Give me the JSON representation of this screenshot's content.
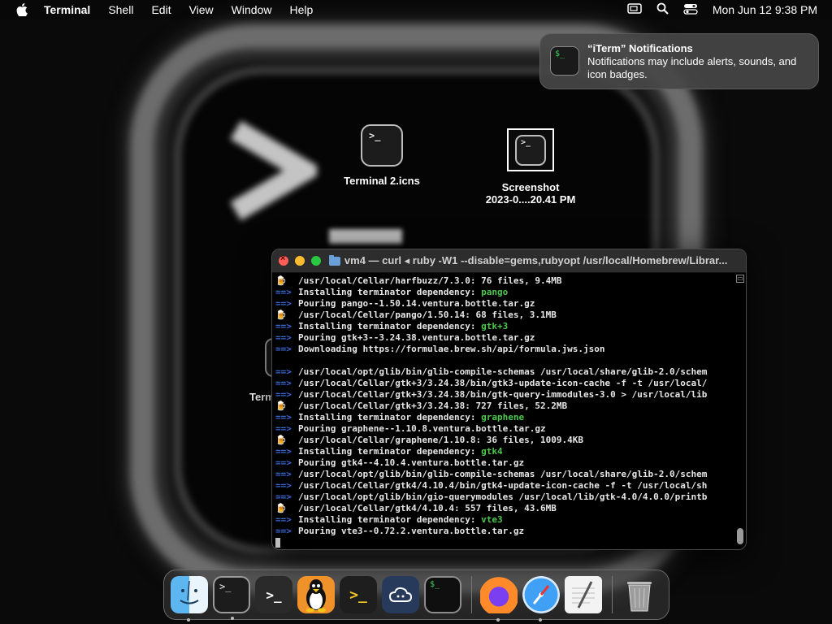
{
  "menubar": {
    "app_name": "Terminal",
    "items": [
      "Shell",
      "Edit",
      "View",
      "Window",
      "Help"
    ],
    "clock": "Mon Jun 12  9:38 PM"
  },
  "notification": {
    "title": "“iTerm” Notifications",
    "body": "Notifications may include alerts, sounds, and icon badges."
  },
  "desktop": {
    "icons": [
      {
        "label": "Terminal 2.icns"
      },
      {
        "label_line1": "Screenshot",
        "label_line2": "2023-0....20.41 PM"
      },
      {
        "label": "Term"
      }
    ]
  },
  "terminal": {
    "title": "vm4 — curl ◂ ruby -W1 --disable=gems,rubyopt /usr/local/Homebrew/Librar...",
    "lines": [
      {
        "kind": "beer",
        "text": "/usr/local/Cellar/harfbuzz/7.3.0: 76 files, 9.4MB"
      },
      {
        "kind": "arrow",
        "text": "Installing terminator dependency: ",
        "extra": "pango"
      },
      {
        "kind": "arrow",
        "text": "Pouring pango--1.50.14.ventura.bottle.tar.gz"
      },
      {
        "kind": "beer",
        "text": "/usr/local/Cellar/pango/1.50.14: 68 files, 3.1MB"
      },
      {
        "kind": "arrow",
        "text": "Installing terminator dependency: ",
        "extra": "gtk+3"
      },
      {
        "kind": "arrow",
        "text": "Pouring gtk+3--3.24.38.ventura.bottle.tar.gz"
      },
      {
        "kind": "arrow",
        "text": "Downloading https://formulae.brew.sh/api/formula.jws.json"
      },
      {
        "kind": "blank",
        "text": ""
      },
      {
        "kind": "arrow",
        "text": "/usr/local/opt/glib/bin/glib-compile-schemas /usr/local/share/glib-2.0/schem"
      },
      {
        "kind": "arrow",
        "text": "/usr/local/Cellar/gtk+3/3.24.38/bin/gtk3-update-icon-cache -f -t /usr/local/"
      },
      {
        "kind": "arrow",
        "text": "/usr/local/Cellar/gtk+3/3.24.38/bin/gtk-query-immodules-3.0 > /usr/local/lib"
      },
      {
        "kind": "beer",
        "text": "/usr/local/Cellar/gtk+3/3.24.38: 727 files, 52.2MB"
      },
      {
        "kind": "arrow",
        "text": "Installing terminator dependency: ",
        "extra": "graphene"
      },
      {
        "kind": "arrow",
        "text": "Pouring graphene--1.10.8.ventura.bottle.tar.gz"
      },
      {
        "kind": "beer",
        "text": "/usr/local/Cellar/graphene/1.10.8: 36 files, 1009.4KB"
      },
      {
        "kind": "arrow",
        "text": "Installing terminator dependency: ",
        "extra": "gtk4"
      },
      {
        "kind": "arrow",
        "text": "Pouring gtk4--4.10.4.ventura.bottle.tar.gz"
      },
      {
        "kind": "arrow",
        "text": "/usr/local/opt/glib/bin/glib-compile-schemas /usr/local/share/glib-2.0/schem"
      },
      {
        "kind": "arrow",
        "text": "/usr/local/Cellar/gtk4/4.10.4/bin/gtk4-update-icon-cache -f -t /usr/local/sh"
      },
      {
        "kind": "arrow",
        "text": "/usr/local/opt/glib/bin/gio-querymodules /usr/local/lib/gtk-4.0/4.0.0/printb"
      },
      {
        "kind": "beer",
        "text": "/usr/local/Cellar/gtk4/4.10.4: 557 files, 43.6MB"
      },
      {
        "kind": "arrow",
        "text": "Installing terminator dependency: ",
        "extra": "vte3"
      },
      {
        "kind": "arrow",
        "text": "Pouring vte3--0.72.2.ventura.bottle.tar.gz"
      }
    ],
    "arrow_glyph": "==>",
    "beer_glyph": "🍺"
  },
  "dock": {
    "items": [
      {
        "name": "finder-icon",
        "running": true
      },
      {
        "name": "terminal-icon",
        "running": true,
        "glyph": ">_"
      },
      {
        "name": "terminal-dark-icon",
        "running": false,
        "glyph": ">_"
      },
      {
        "name": "linux-penguin-icon",
        "running": false
      },
      {
        "name": "shell-prompt-icon",
        "running": false,
        "glyph": ">_"
      },
      {
        "name": "cloud-app-icon",
        "running": false
      },
      {
        "name": "iterm-icon",
        "running": false,
        "glyph": "$_"
      },
      {
        "name": "firefox-icon",
        "running": true
      },
      {
        "name": "safari-icon",
        "running": true
      },
      {
        "name": "textedit-icon",
        "running": false
      },
      {
        "name": "trash-icon",
        "running": false
      }
    ]
  }
}
